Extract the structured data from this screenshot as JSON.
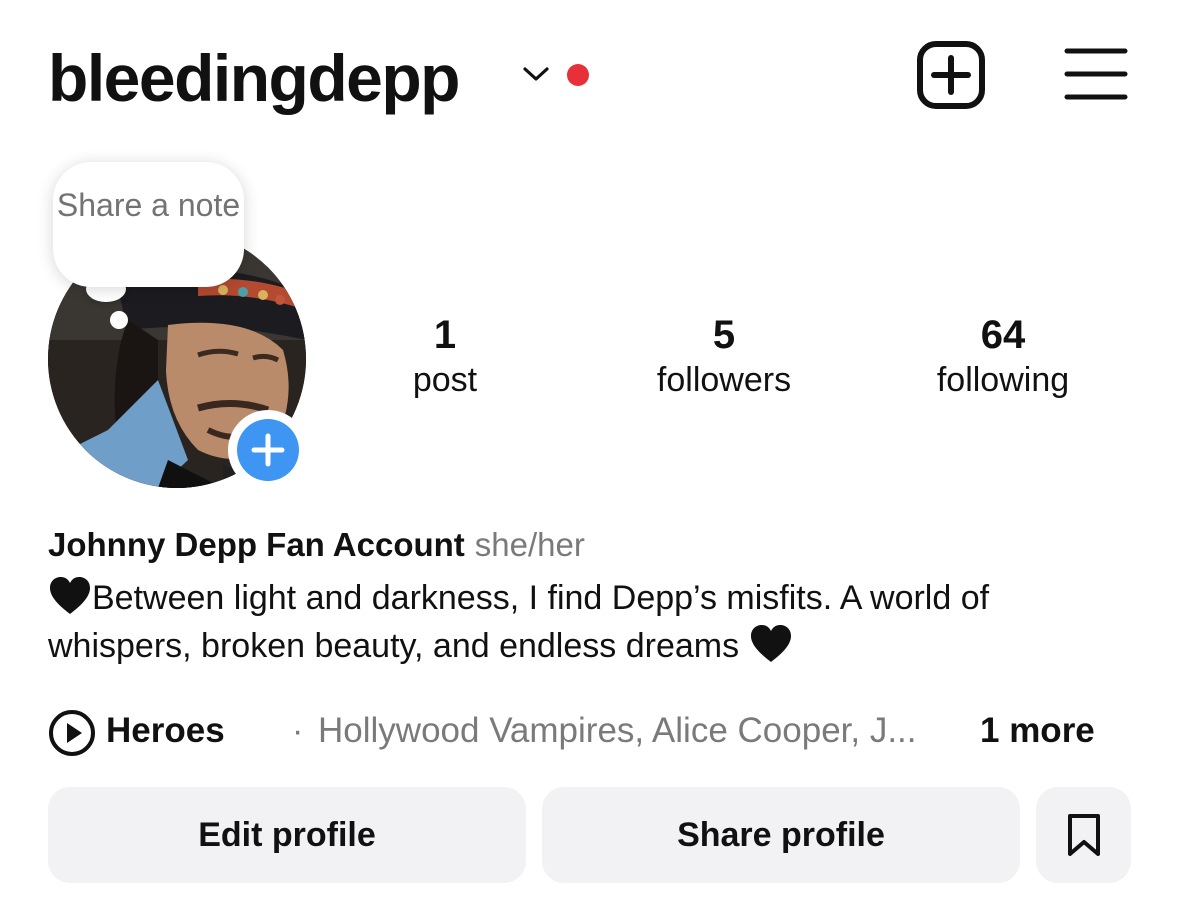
{
  "header": {
    "username": "bleedingdepp",
    "username_dropdown_icon": "chevron-down-icon",
    "notification_dot_color": "#e8303a",
    "create_icon": "plus-square-icon",
    "menu_icon": "hamburger-menu-icon"
  },
  "note": {
    "text": "Share a note"
  },
  "avatar": {
    "add_story_icon": "plus-icon",
    "add_story_color": "#3f95f2"
  },
  "stats": [
    {
      "value": "1",
      "label": "post"
    },
    {
      "value": "5",
      "label": "followers"
    },
    {
      "value": "64",
      "label": "following"
    }
  ],
  "profile": {
    "display_name": "Johnny Depp Fan Account",
    "pronouns": "she/her",
    "bio_part1": "Between light and darkness, I find Depp’s misfits. A world of whispers, broken beauty, and endless dreams",
    "bio_emoji_icon": "black-heart-icon"
  },
  "music": {
    "icon": "play-circle-icon",
    "title": "Heroes",
    "separator": "·",
    "artists": "Hollywood Vampires, Alice Cooper, J...",
    "more": "1 more"
  },
  "actions": {
    "edit_profile": "Edit profile",
    "share_profile": "Share profile",
    "save_icon": "bookmark-icon"
  }
}
